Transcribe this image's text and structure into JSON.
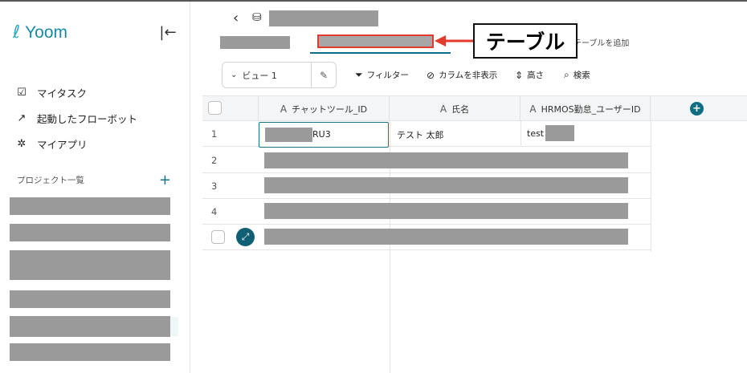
{
  "sidebar": {
    "logo": "Yoom",
    "logo_mark": "ℓ",
    "nav": [
      {
        "label": "マイタスク",
        "icon": "checkbox-icon"
      },
      {
        "label": "起動したフローボット",
        "icon": "flow-arrow-icon"
      },
      {
        "label": "マイアプリ",
        "icon": "app-network-icon"
      }
    ],
    "projects_label": "プロジェクト一覧",
    "projects_add": "+"
  },
  "header": {
    "tab_add_label": "テーブルを追加",
    "callout_label": "テーブル"
  },
  "toolbar": {
    "view_label": "ビュー 1",
    "filter": "フィルター",
    "hide_columns": "カラムを非表示",
    "height": "高さ",
    "search": "検索"
  },
  "table": {
    "columns": [
      "チャットツール_ID",
      "氏名",
      "HRMOS勤怠_ユーザーID"
    ],
    "rows": [
      {
        "num": "1",
        "chat_id_suffix": "RU3",
        "name": "テスト 太郎",
        "user_id_prefix": "test"
      },
      {
        "num": "2"
      },
      {
        "num": "3"
      },
      {
        "num": "4"
      }
    ]
  },
  "colors": {
    "brand": "#1b89a6",
    "accent": "#0f6d83",
    "annotation": "#e23b2e"
  }
}
